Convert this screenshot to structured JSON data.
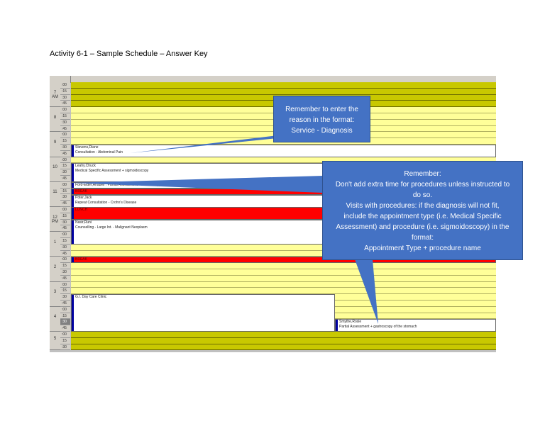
{
  "title": "Activity 6-1 – Sample Schedule – Answer Key",
  "hours": [
    {
      "label": "7",
      "sub": "AM",
      "start": 0
    },
    {
      "label": "8",
      "start": 4
    },
    {
      "label": "9",
      "start": 8
    },
    {
      "label": "10",
      "start": 12
    },
    {
      "label": "11",
      "start": 16
    },
    {
      "label": "12",
      "sub": "PM",
      "start": 20
    },
    {
      "label": "1",
      "start": 24
    },
    {
      "label": "2",
      "start": 28
    },
    {
      "label": "3",
      "start": 32
    },
    {
      "label": "4",
      "start": 36
    },
    {
      "label": "5",
      "start": 40
    }
  ],
  "minutes": [
    ":00",
    ":15",
    ":30",
    ":45"
  ],
  "appointments": [
    {
      "name": "Stevens,Diane",
      "reason": "Consultation - Abdominal Pain"
    },
    {
      "name": "Leahy,Chuck",
      "reason": "Medical Specific Assessment + sigmoidoscopy"
    },
    {
      "name": "Ford-Elder,Anabell : Partial Assessment - Rectal Polyps"
    },
    {
      "name": "BREAK"
    },
    {
      "name": "Poter,Jack",
      "reason": "Repeat Consultation - Crohn's Disease"
    },
    {
      "name": "LUNCH"
    },
    {
      "name": "Nasir,Runi",
      "reason": "Counselling - Large Int. - Malignant Neoplasm"
    },
    {
      "name": "BREAK"
    },
    {
      "name": "G.I. Day Care Clinic"
    },
    {
      "name": "Smythe,Rosie",
      "reason": "Partial Assessment + gastroscopy of the stomach"
    }
  ],
  "callouts": {
    "first": [
      "Remember to enter the",
      "reason in the format:",
      "Service - Diagnosis"
    ],
    "second": [
      "Remember:",
      "Don't add extra time for procedures unless instructed to",
      "do so.",
      "Visits with procedures: if the diagnosis will not fit,",
      "include the appointment type (i.e. Medical Specific",
      "Assessment) and procedure (i.e. sigmoidoscopy) in the",
      "format:",
      "Appointment Type + procedure name"
    ]
  },
  "colors": {
    "callout": "#4472c4",
    "olive": "#c8c800",
    "yellow": "#ffff99",
    "block": "#ff0000"
  }
}
